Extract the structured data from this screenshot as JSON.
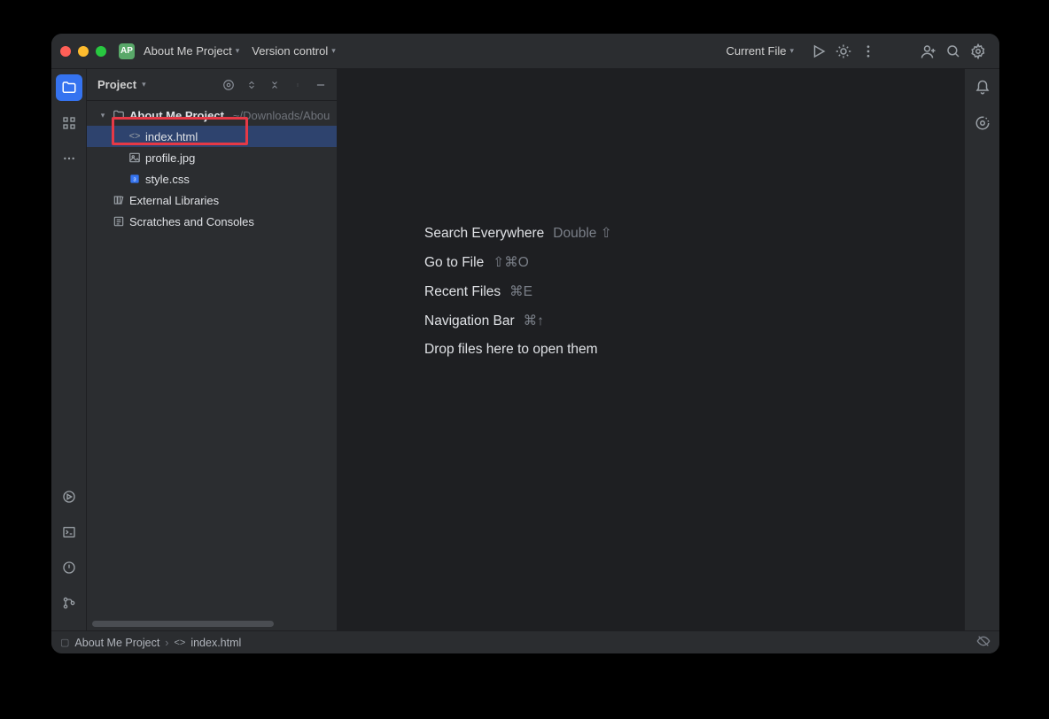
{
  "titlebar": {
    "project_badge": "AP",
    "project_name": "About Me Project",
    "vcs_label": "Version control",
    "run_config": "Current File"
  },
  "panel": {
    "title": "Project"
  },
  "tree": {
    "root": {
      "name": "About Me Project",
      "path": "~/Downloads/Abou"
    },
    "files": [
      {
        "name": "index.html",
        "icon": "html",
        "selected": true,
        "highlighted": true
      },
      {
        "name": "profile.jpg",
        "icon": "image",
        "selected": false,
        "highlighted": false
      },
      {
        "name": "style.css",
        "icon": "css",
        "selected": false,
        "highlighted": false
      }
    ],
    "external": "External Libraries",
    "scratches": "Scratches and Consoles"
  },
  "welcome": [
    {
      "label": "Search Everywhere",
      "shortcut": "Double ⇧"
    },
    {
      "label": "Go to File",
      "shortcut": "⇧⌘O"
    },
    {
      "label": "Recent Files",
      "shortcut": "⌘E"
    },
    {
      "label": "Navigation Bar",
      "shortcut": "⌘↑"
    },
    {
      "label": "Drop files here to open them",
      "shortcut": ""
    }
  ],
  "status": {
    "crumb_project": "About Me Project",
    "crumb_file": "index.html"
  },
  "icons": {
    "run": "▶",
    "debug": "⚙",
    "more": "⋮",
    "code_with_me": "👤",
    "search": "🔍",
    "settings": "⚙",
    "notifications": "🔔",
    "ai": "⟳"
  }
}
